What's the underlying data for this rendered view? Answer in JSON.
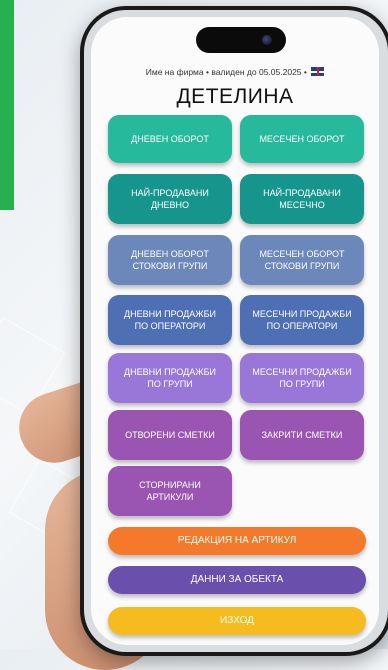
{
  "header": {
    "subtitle": "Име на фирма • валиден до 05.05.2025 •",
    "language_flag": "uk-flag-icon",
    "title": "ДЕТЕЛИНА"
  },
  "buttons": {
    "daily_turnover": "ДНЕВЕН ОБОРОТ",
    "monthly_turnover": "МЕСЕЧЕН ОБОРОТ",
    "top_daily": "НАЙ-ПРОДАВАНИ\nДНЕВНО",
    "top_monthly": "НАЙ-ПРОДАВАНИ\nМЕСЕЧНО",
    "daily_groups_turnover": "ДНЕВЕН ОБОРОТ\nСТОКОВИ ГРУПИ",
    "monthly_groups_turnover": "МЕСЕЧЕН ОБОРОТ\nСТОКОВИ ГРУПИ",
    "daily_by_operator": "ДНЕВНИ ПРОДАЖБИ\nПО ОПЕРАТОРИ",
    "monthly_by_operator": "МЕСЕЧНИ ПРОДАЖБИ\nПО ОПЕРАТОРИ",
    "daily_by_group": "ДНЕВНИ ПРОДАЖБИ\nПО ГРУПИ",
    "monthly_by_group": "МЕСЕЧНИ ПРОДАЖБИ\nПО ГРУПИ",
    "open_bills": "ОТВОРЕНИ СМЕТКИ",
    "closed_bills": "ЗАКРИТИ СМЕТКИ",
    "voided_items": "СТОРНИРАНИ\nАРТИКУЛИ",
    "edit_item": "РЕДАКЦИЯ НА АРТИКУЛ",
    "site_data": "ДАННИ ЗА ОБЕКТА",
    "exit": "ИЗХОД"
  },
  "colors": {
    "teal_light": "#27b99c",
    "teal_dark": "#16958c",
    "steel_blue": "#6c87b9",
    "royal_blue": "#4e6fb4",
    "lavender": "#9877d8",
    "purple": "#9a55b3",
    "orange": "#f4792a",
    "indigo": "#6a4fad",
    "yellow": "#f5bb1f",
    "brand_green": "#27b04f"
  }
}
